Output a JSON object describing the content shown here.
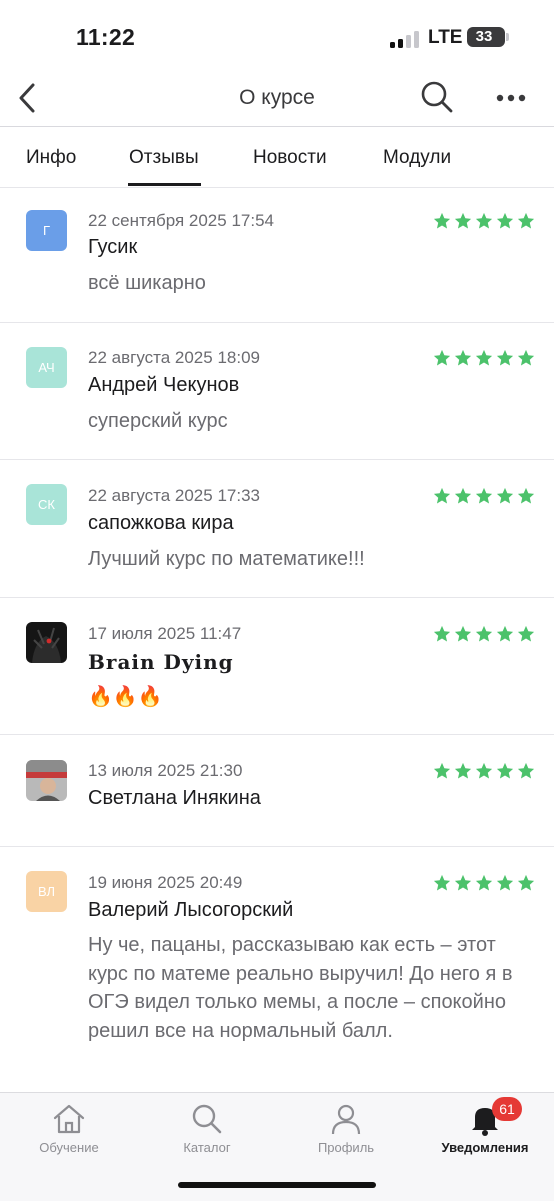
{
  "status_bar": {
    "time": "11:22",
    "network": "LTE",
    "battery": "33"
  },
  "nav": {
    "title": "О курсе",
    "back_icon": "chevron-left-icon",
    "search_icon": "search-icon",
    "more_icon": "more-horizontal-icon"
  },
  "tabs": [
    {
      "label": "Инфо",
      "active": false
    },
    {
      "label": "Отзывы",
      "active": true
    },
    {
      "label": "Новости",
      "active": false
    },
    {
      "label": "Модули",
      "active": false
    }
  ],
  "reviews": [
    {
      "avatar": "Г",
      "avatar_color": "#6a9ee8",
      "date": "22 сентября 2025 17:54",
      "name": "Гусик",
      "text": "всё шикарно",
      "rating": 5
    },
    {
      "avatar": "АЧ",
      "avatar_color": "#a9e4d8",
      "date": "22 августа 2025 18:09",
      "name": "Андрей Чекунов",
      "text": "суперский курс",
      "rating": 5
    },
    {
      "avatar": "СК",
      "avatar_color": "#a9e4d8",
      "date": "22 августа 2025 17:33",
      "name": "сапожкова кира",
      "text": "Лучший курс по математике!!!",
      "rating": 5
    },
    {
      "avatar": "",
      "avatar_color": "#1a1a1a",
      "date": "17 июля 2025 11:47",
      "name": "Brain Dying",
      "text": "🔥🔥🔥",
      "rating": 5
    },
    {
      "avatar": "",
      "avatar_color": "#9a9a9a",
      "date": "13 июля 2025 21:30",
      "name": "Светлана Инякина",
      "text": "",
      "rating": 5
    },
    {
      "avatar": "ВЛ",
      "avatar_color": "#f9d3a5",
      "date": "19 июня 2025 20:49",
      "name": "Валерий Лысогорский",
      "text": "Ну че, пацаны, рассказываю как есть – этот курс по матеме реально выручил! До него я в ОГЭ видел только мемы, а после – спокойно решил все на нормальный балл.",
      "rating": 5
    }
  ],
  "tabbar": [
    {
      "label": "Обучение",
      "icon": "home-icon",
      "active": false
    },
    {
      "label": "Каталог",
      "icon": "search-icon",
      "active": false
    },
    {
      "label": "Профиль",
      "icon": "user-icon",
      "active": false
    },
    {
      "label": "Уведомления",
      "icon": "bell-icon",
      "active": true,
      "badge": "61"
    }
  ],
  "colors": {
    "star": "#4cc26b",
    "badge": "#e53935"
  }
}
